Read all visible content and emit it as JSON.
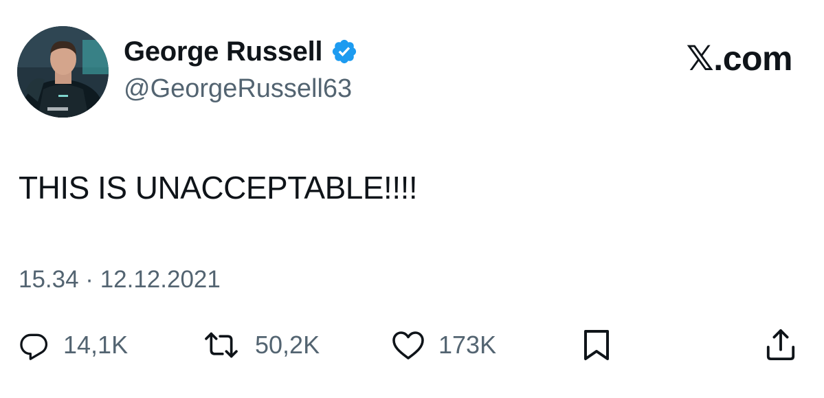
{
  "author": {
    "display_name": "George Russell",
    "handle": "@GeorgeRussell63",
    "verified": true,
    "avatar_icon": "profile-photo-avatar"
  },
  "site_label": "𝕏.com",
  "tweet": {
    "text": "THIS IS UNACCEPTABLE!!!!",
    "timestamp": "15.34 · 12.12.2021"
  },
  "actions": {
    "replies": {
      "icon": "reply-icon",
      "count": "14,1K"
    },
    "retweets": {
      "icon": "retweet-icon",
      "count": "50,2K"
    },
    "likes": {
      "icon": "heart-icon",
      "count": "173K"
    },
    "bookmark": {
      "icon": "bookmark-icon"
    },
    "share": {
      "icon": "share-icon"
    }
  },
  "colors": {
    "text_primary": "#0f1419",
    "text_secondary": "#536471",
    "verified_blue": "#1d9bf0",
    "background": "#ffffff"
  }
}
